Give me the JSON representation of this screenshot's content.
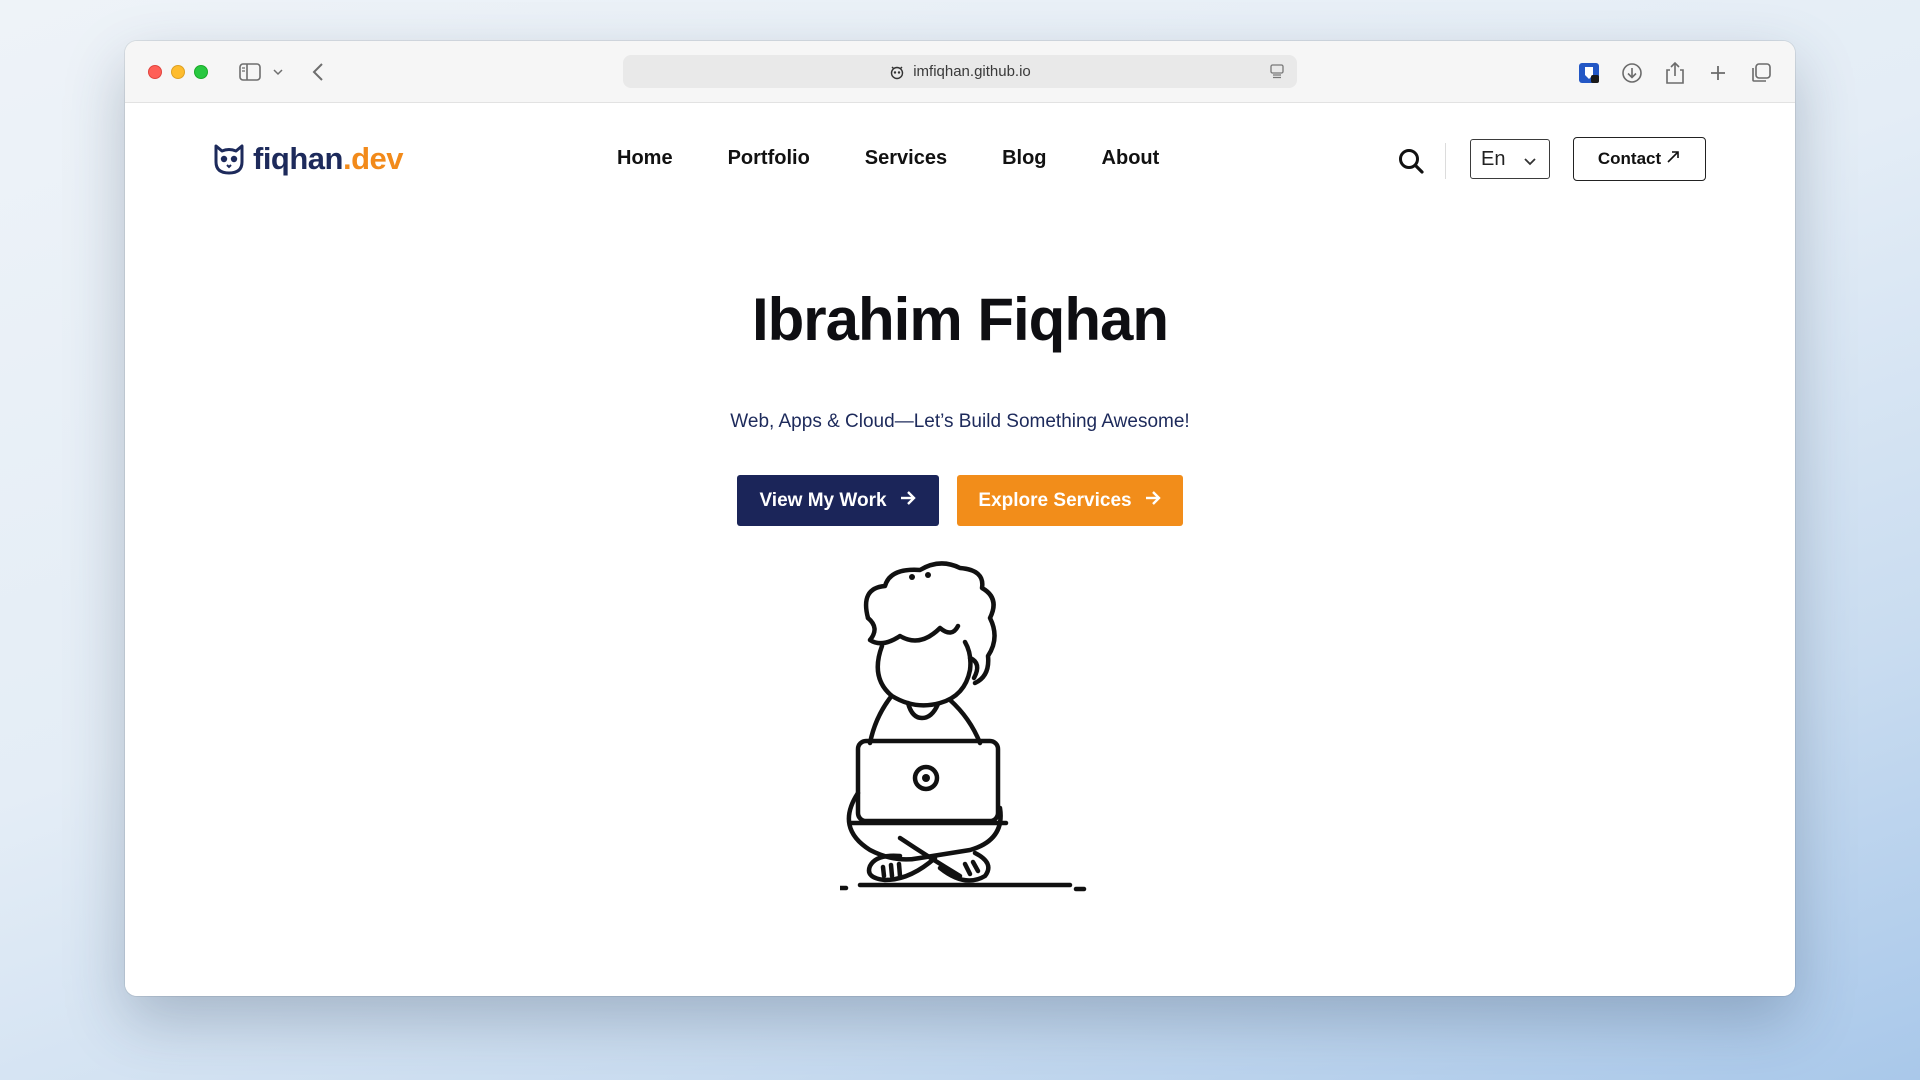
{
  "browser": {
    "url": "imfiqhan.github.io"
  },
  "site": {
    "logo": {
      "name_part": "fiqhan",
      "tld_part": ".dev"
    },
    "nav": {
      "items": [
        {
          "label": "Home"
        },
        {
          "label": "Portfolio"
        },
        {
          "label": "Services"
        },
        {
          "label": "Blog"
        },
        {
          "label": "About"
        }
      ]
    },
    "language": {
      "selected": "En"
    },
    "contact_label": "Contact"
  },
  "hero": {
    "title": "Ibrahim Fiqhan",
    "subtitle": "Web, Apps & Cloud—Let’s Build Something Awesome!",
    "primary_cta": "View My Work",
    "secondary_cta": "Explore Services"
  },
  "colors": {
    "navy": "#1b2559",
    "orange": "#f28d1a"
  },
  "icons": [
    "sidebar-toggle-icon",
    "chevron-down-icon",
    "back-arrow-icon",
    "site-favicon-icon",
    "reader-icon",
    "extension-icon",
    "download-icon",
    "share-icon",
    "new-tab-icon",
    "tab-overview-icon",
    "owl-logo-icon",
    "search-icon",
    "chevron-down-icon",
    "external-arrow-icon",
    "arrow-right-icon"
  ]
}
